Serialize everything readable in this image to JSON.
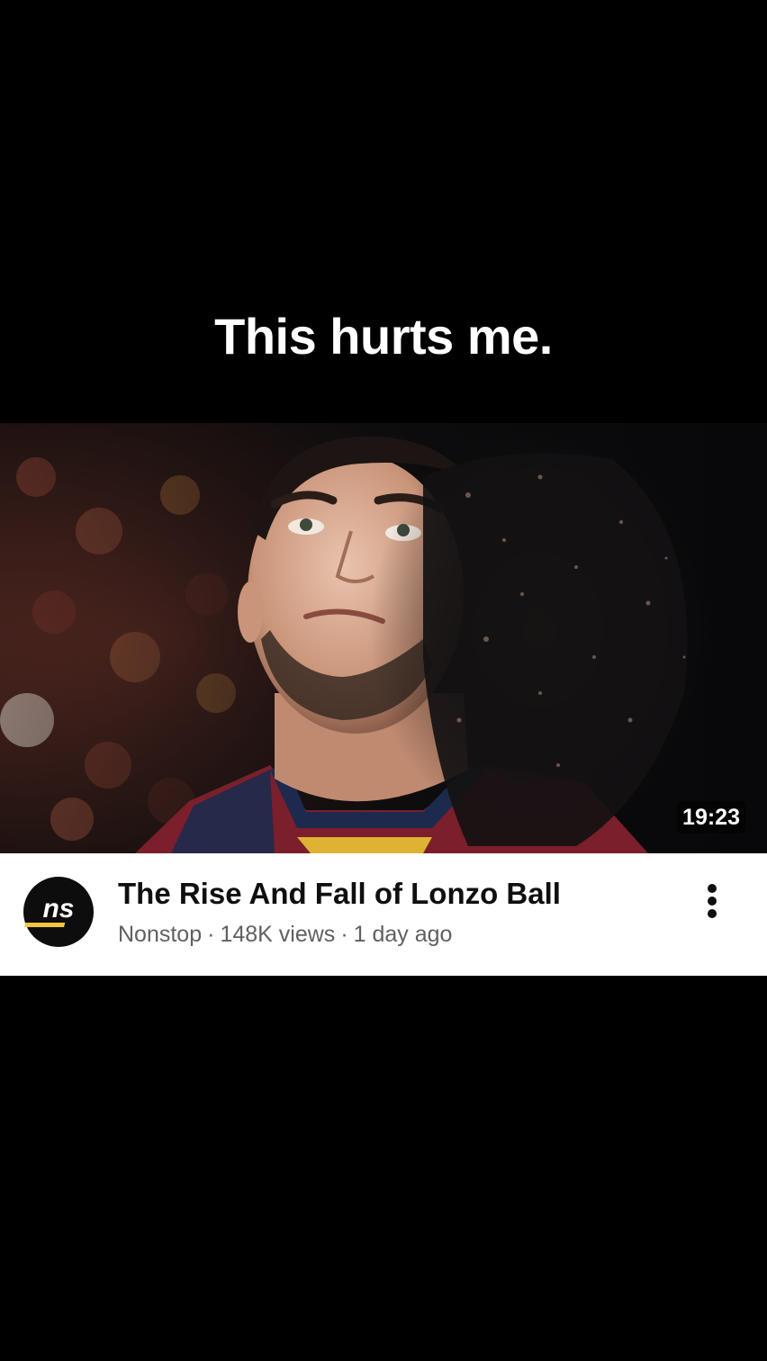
{
  "caption": {
    "text": "This hurts me."
  },
  "video": {
    "duration": "19:23",
    "title": "The Rise And Fall of Lonzo Ball",
    "channel": "Nonstop",
    "views": "148K views",
    "age": "1 day ago",
    "separator": "·"
  },
  "channel_avatar": {
    "icon": "nonstop-logo-icon",
    "logo_text": "ns",
    "accent_color": "#f5c542"
  },
  "more_menu": {
    "icon": "more-vertical-icon"
  },
  "colors": {
    "background": "#000000",
    "card": "#ffffff",
    "title": "#0f0f0f",
    "meta": "#606060",
    "jersey": "#7a1f2b",
    "jersey_trim": "#1d2a4d"
  }
}
